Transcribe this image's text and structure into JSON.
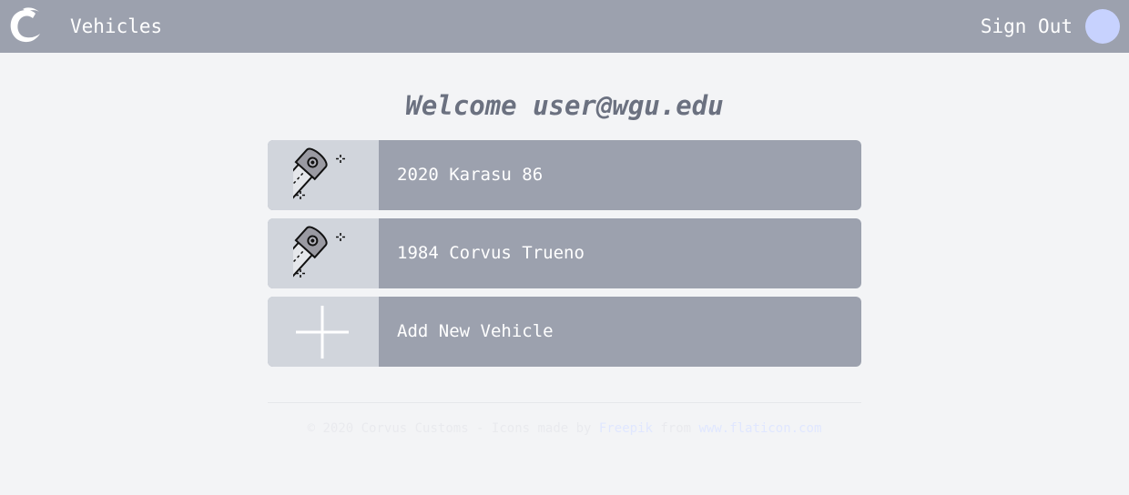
{
  "header": {
    "logo_icon": "corvus-c-logo",
    "title": "Vehicles",
    "sign_out_label": "Sign Out",
    "avatar_color": "#c7d2fe"
  },
  "main": {
    "welcome": "Welcome user@wgu.edu",
    "vehicles": [
      {
        "name": "2020 Karasu 86",
        "icon": "car-key-icon"
      },
      {
        "name": "1984 Corvus Trueno",
        "icon": "car-key-icon"
      }
    ],
    "add_vehicle": {
      "label": "Add New Vehicle",
      "icon": "plus-icon"
    }
  },
  "footer": {
    "prefix": "© 2020 Corvus Customs - Icons made by ",
    "author_link": "Freepik",
    "middle": " from ",
    "site_link": "www.flaticon.com"
  },
  "colors": {
    "header_bg": "#9ca1ae",
    "page_bg": "#f3f4f6",
    "card_bg": "#9ca1ae",
    "thumb_bg": "#d1d5dc",
    "welcome_text": "#6b7180"
  }
}
